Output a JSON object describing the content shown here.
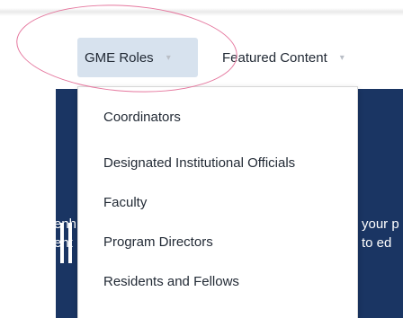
{
  "nav": {
    "items": [
      {
        "label": "GME Roles",
        "caret": "▾",
        "active": true
      },
      {
        "label": "Featured Content",
        "caret": "▾",
        "active": false
      }
    ]
  },
  "dropdown": {
    "items": [
      {
        "label": "Coordinators"
      },
      {
        "label": "Designated Institutional Officials"
      },
      {
        "label": "Faculty"
      },
      {
        "label": "Program Directors"
      },
      {
        "label": "Residents and Fellows"
      }
    ]
  },
  "hero": {
    "left_line1": "enh",
    "left_line2": "ent",
    "right_line1": "your p",
    "right_line2": "to ed"
  },
  "annotation": {
    "color": "#e5779e",
    "shape": "ellipse"
  },
  "colors": {
    "hero_bg": "#1a3563",
    "active_tab_bg": "#d7e2ee",
    "text": "#222a35"
  }
}
